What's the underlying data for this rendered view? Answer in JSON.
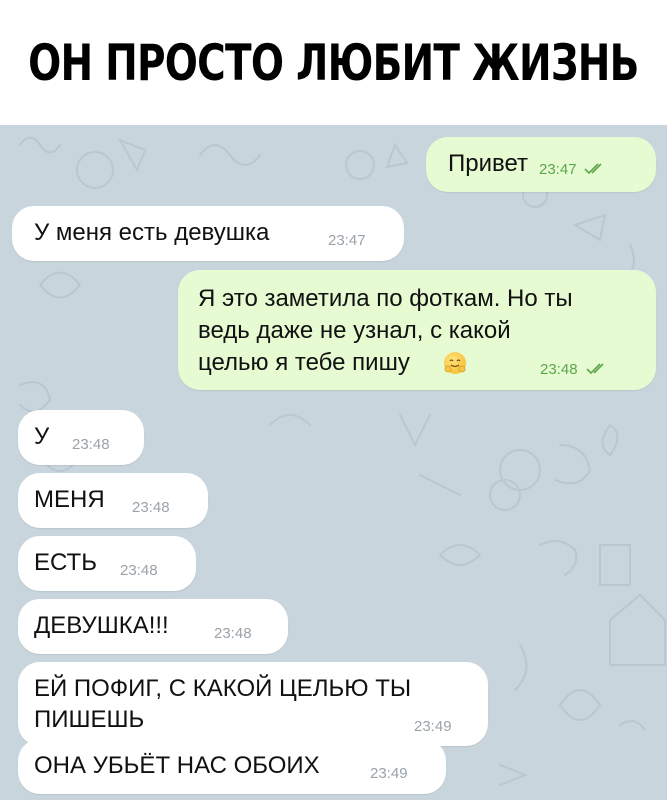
{
  "header": {
    "title": "ОН ПРОСТО ЛЮБИТ ЖИЗНЬ"
  },
  "chat": {
    "messages": [
      {
        "side": "out",
        "lines": [
          "Привет"
        ],
        "time": "23:47",
        "read": true
      },
      {
        "side": "in",
        "lines": [
          "У меня есть девушка"
        ],
        "time": "23:47"
      },
      {
        "side": "out",
        "lines": [
          "Я это заметила по фоткам. Но ты",
          "ведь даже не узнал, с какой",
          "целью я тебе пишу"
        ],
        "emoji": "hugging-face",
        "time": "23:48",
        "read": true
      },
      {
        "side": "in",
        "lines": [
          "У"
        ],
        "time": "23:48"
      },
      {
        "side": "in",
        "lines": [
          "МЕНЯ"
        ],
        "time": "23:48"
      },
      {
        "side": "in",
        "lines": [
          "ЕСТЬ"
        ],
        "time": "23:48"
      },
      {
        "side": "in",
        "lines": [
          "ДЕВУШКА!!!"
        ],
        "time": "23:48"
      },
      {
        "side": "in",
        "lines": [
          "ЕЙ ПОФИГ, С КАКОЙ ЦЕЛЬЮ ТЫ",
          "ПИШЕШЬ"
        ],
        "time": "23:49"
      },
      {
        "side": "in",
        "lines": [
          "ОНА УБЬЁТ НАС ОБОИХ"
        ],
        "time": "23:49"
      }
    ]
  },
  "colors": {
    "chat_background": "#c9d5dd",
    "incoming_bubble": "#ffffff",
    "outgoing_bubble": "#e6fbd2",
    "read_ticks": "#5da64a"
  },
  "icons": {
    "read_status": "double-check-icon",
    "emoji": "hugging-face-emoji-icon",
    "wallpaper": "doodle-pattern"
  }
}
